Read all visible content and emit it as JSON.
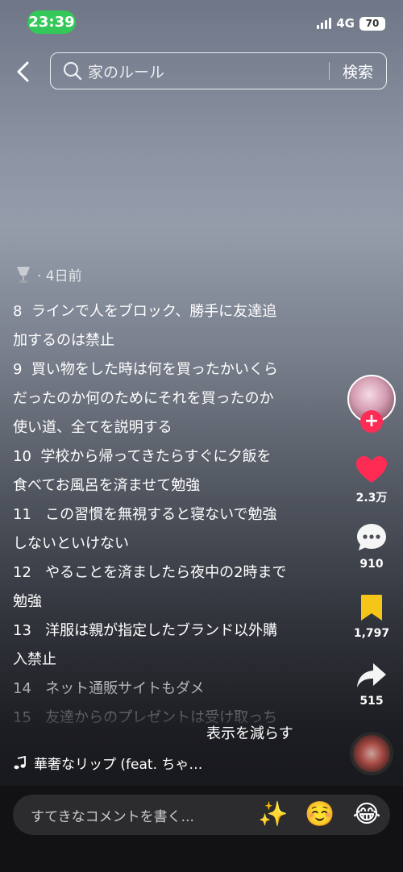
{
  "status": {
    "time": "23:39",
    "network": "4G",
    "battery": "70"
  },
  "search": {
    "query": "家のルール",
    "button": "検索"
  },
  "post": {
    "age": "· 4日前",
    "caption_lines": [
      "8  ラインで人をブロック、勝手に友達追",
      "加するのは禁止",
      "9  買い物をした時は何を買ったかいくら",
      "だったのか何のためにそれを買ったのか",
      "使い道、全てを説明する",
      "10  学校から帰ってきたらすぐに夕飯を",
      "食べてお風呂を済ませて勉強",
      "11   この習慣を無視すると寝ないで勉強",
      "しないといけない",
      "12   やることを済ましたら夜中の2時まで",
      "勉強",
      "13   洋服は親が指定したブランド以外購",
      "入禁止",
      "14   ネット通販サイトもダメ",
      "15   友達からのプレゼントは受け取っち"
    ],
    "show_less": "表示を減らす",
    "music": "華奢なリップ (feat. ちゃ…"
  },
  "rail": {
    "likes": "2.3万",
    "comments": "910",
    "saves": "1,797",
    "shares": "515"
  },
  "comment": {
    "placeholder": "すてきなコメントを書く...",
    "emojis": [
      "✨",
      "☺️",
      "😂"
    ]
  },
  "colors": {
    "like": "#fe2c55",
    "save": "#f5c518",
    "status_pill": "#34c759"
  }
}
